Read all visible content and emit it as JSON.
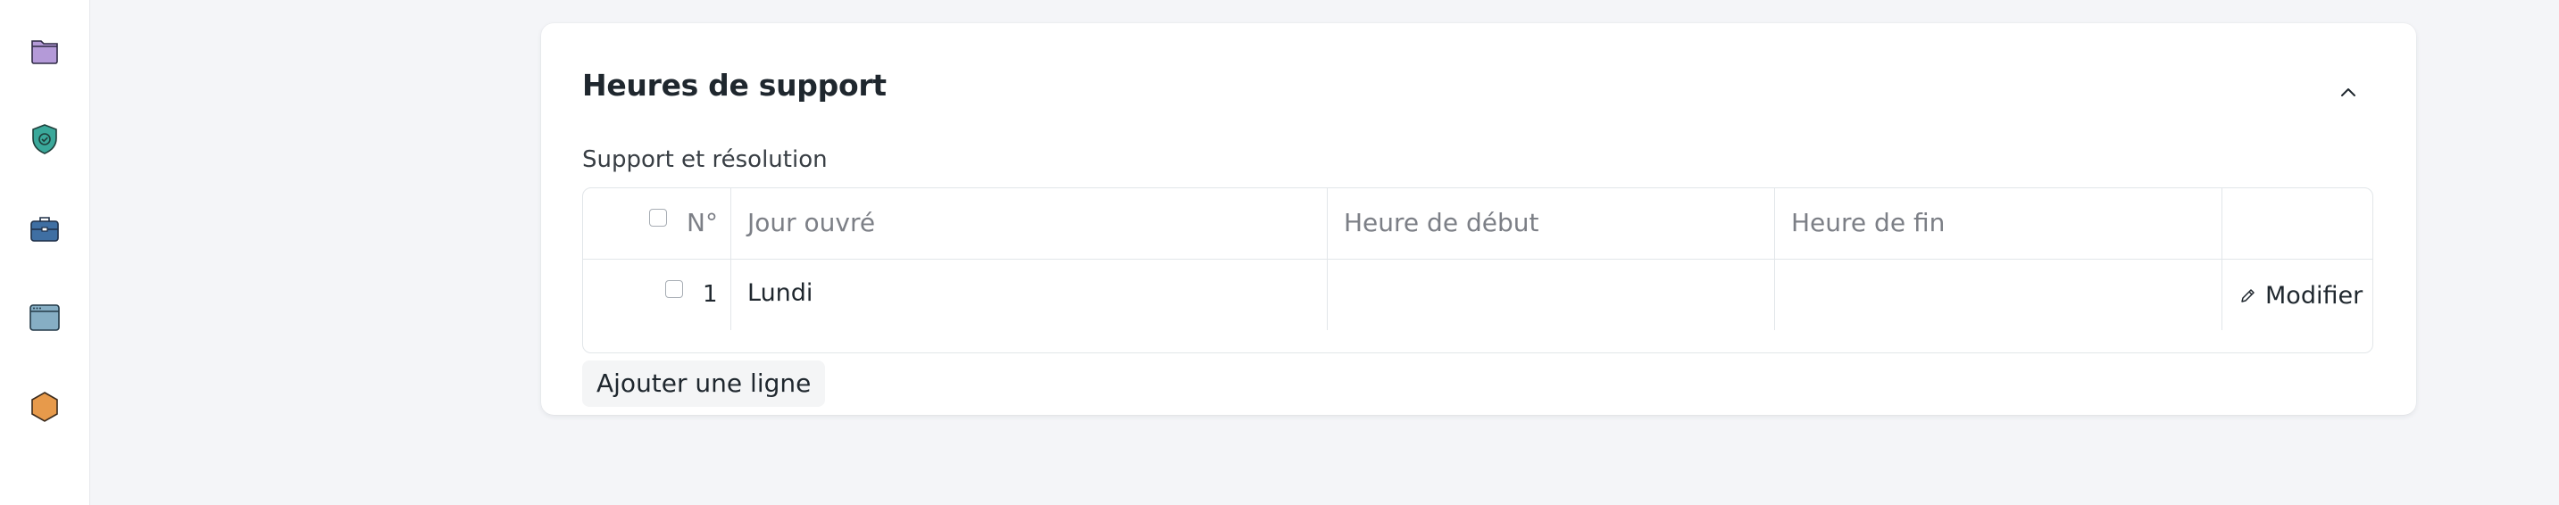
{
  "sidebar": {
    "icons": [
      "folder-icon",
      "shield-check-icon",
      "briefcase-icon",
      "browser-window-icon",
      "hexagon-icon"
    ]
  },
  "section": {
    "title": "Heures de support",
    "subtitle": "Support et résolution"
  },
  "table": {
    "columns": [
      "N°",
      "Jour ouvré",
      "Heure de début",
      "Heure de fin",
      ""
    ],
    "rows": [
      {
        "no": "1",
        "day": "Lundi",
        "start": "",
        "end": "",
        "action": "Modifier"
      }
    ]
  },
  "add_row_label": "Ajouter une ligne",
  "colors": {
    "background": "#f4f5f8",
    "card": "#ffffff",
    "border": "#e2e6e9",
    "muted_text": "#7c7f86"
  }
}
